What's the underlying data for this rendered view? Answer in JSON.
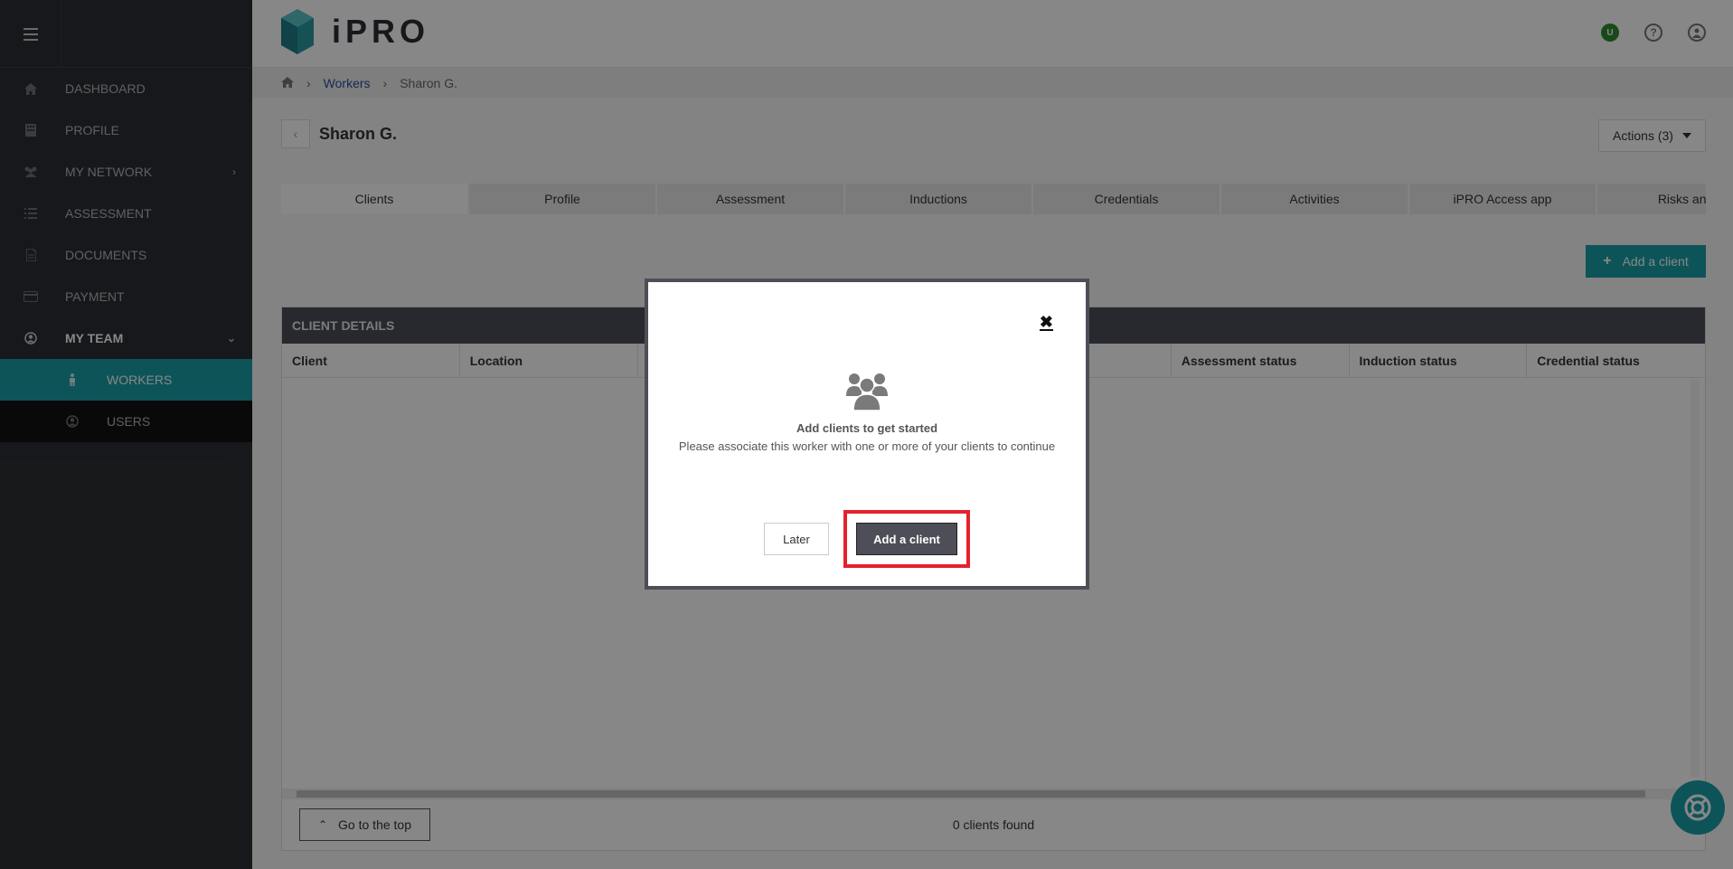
{
  "app": {
    "logo_text": "iPRO"
  },
  "sidebar": {
    "items": [
      {
        "label": "DASHBOARD",
        "icon": "home-icon"
      },
      {
        "label": "PROFILE",
        "icon": "building-icon"
      },
      {
        "label": "MY NETWORK",
        "icon": "network-icon"
      },
      {
        "label": "ASSESSMENT",
        "icon": "list-icon"
      },
      {
        "label": "DOCUMENTS",
        "icon": "document-icon"
      },
      {
        "label": "PAYMENT",
        "icon": "credit-card-icon"
      },
      {
        "label": "MY TEAM",
        "icon": "user-circle-icon"
      },
      {
        "label": "WORKERS",
        "icon": "person-icon"
      },
      {
        "label": "USERS",
        "icon": "user-circle-icon"
      }
    ]
  },
  "header": {
    "badge_text": "U"
  },
  "breadcrumb": {
    "link": "Workers",
    "current": "Sharon G."
  },
  "page": {
    "title": "Sharon G.",
    "actions_label": "Actions (3)",
    "add_client_label": "Add a client"
  },
  "tabs": [
    "Clients",
    "Profile",
    "Assessment",
    "Inductions",
    "Credentials",
    "Activities",
    "iPRO Access app",
    "Risks and c"
  ],
  "panel": {
    "title": "CLIENT DETAILS",
    "columns": [
      "Client",
      "Location",
      "",
      "",
      "",
      "",
      "Assessment status",
      "Induction status",
      "Credential status"
    ],
    "go_top_label": "Go to the top",
    "count_text": "0 clients found"
  },
  "modal": {
    "title": "Add clients to get started",
    "text": "Please associate this worker with one or more of your clients to continue",
    "later_label": "Later",
    "add_label": "Add a client"
  },
  "colors": {
    "accent": "#1a9fa8",
    "sidebar_bg": "#2d2f33",
    "highlight": "#e3222c"
  }
}
